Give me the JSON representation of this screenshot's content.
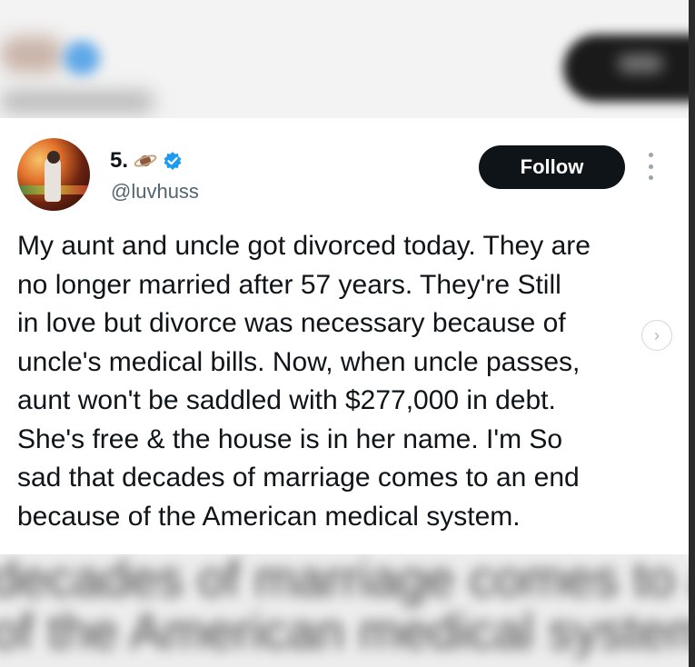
{
  "user": {
    "display_name": "5.",
    "handle": "@luvhuss",
    "verified": true
  },
  "follow_label": "Follow",
  "tweet": {
    "text": "My aunt and uncle got divorced today. They are\nno longer married after 57 years. They're Still\nin love but divorce was necessary because of\nuncle's medical bills. Now, when uncle passes,\naunt won't be saddled with $277,000 in debt.\nShe's free & the house is in her name. I'm  So\nsad that decades of marriage comes to an end\nbecause of the American medical system."
  },
  "blurred_background": {
    "line1": "decades of marriage comes to a",
    "line2": "of the American medical system"
  },
  "colors": {
    "follow_bg": "#0f1419",
    "verified": "#1d9bf0",
    "handle": "#536471"
  }
}
